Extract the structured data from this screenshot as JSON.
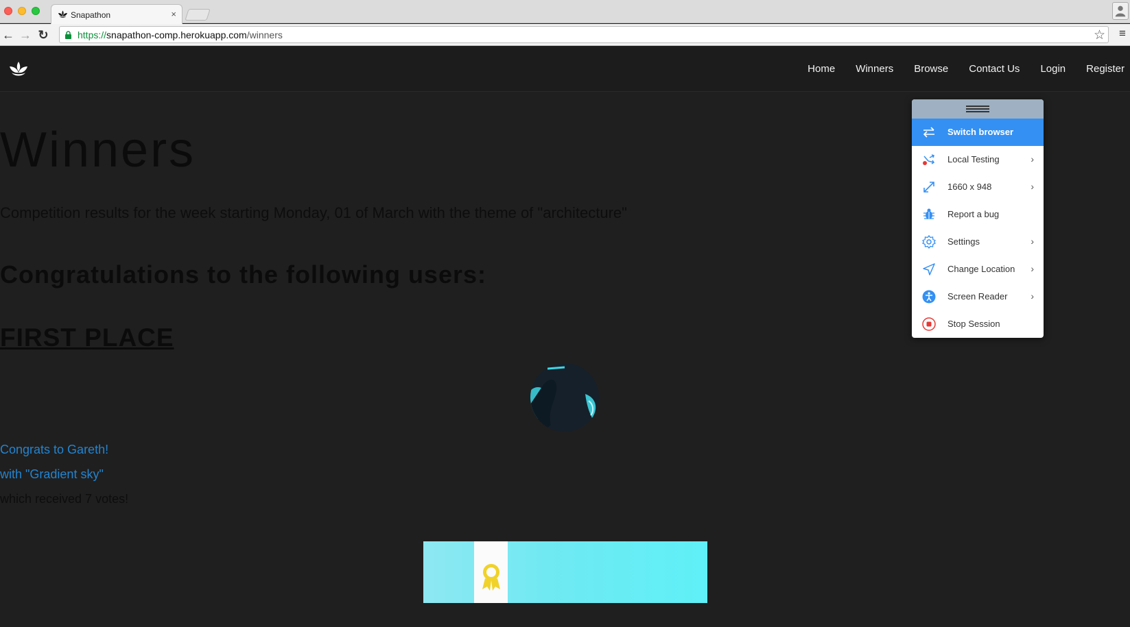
{
  "browser": {
    "tab_title": "Snapathon",
    "tab_close": "×",
    "url_scheme": "https://",
    "url_host": "snapathon-comp.herokuapp.com",
    "url_path": "/winners",
    "back_glyph": "←",
    "forward_glyph": "→",
    "reload_glyph": "↻",
    "star_glyph": "☆",
    "menu_glyph": "≡"
  },
  "nav": {
    "links": [
      "Home",
      "Winners",
      "Browse",
      "Contact Us",
      "Login",
      "Register"
    ]
  },
  "page": {
    "heading": "Winners",
    "subtitle": "Competition results for the week starting Monday, 01 of March with the theme of \"architecture\"",
    "congrats_heading": "Congratulations to the following users:",
    "place_label": "FIRST PLACE",
    "winner_line": "Congrats to Gareth!",
    "photo_line": "with \"Gradient sky\"",
    "votes_line": "which received 7 votes!"
  },
  "bs_menu": {
    "items": [
      {
        "label": "Switch browser",
        "icon": "switch-icon",
        "chevron": ""
      },
      {
        "label": "Local Testing",
        "icon": "local-testing-icon",
        "chevron": "›"
      },
      {
        "label": "1660 x 948",
        "icon": "resize-icon",
        "chevron": "›"
      },
      {
        "label": "Report a bug",
        "icon": "bug-icon",
        "chevron": ""
      },
      {
        "label": "Settings",
        "icon": "gear-icon",
        "chevron": "›"
      },
      {
        "label": "Change Location",
        "icon": "location-arrow-icon",
        "chevron": "›"
      },
      {
        "label": "Screen Reader",
        "icon": "accessibility-icon",
        "chevron": "›"
      },
      {
        "label": "Stop Session",
        "icon": "stop-icon",
        "chevron": ""
      }
    ]
  },
  "colors": {
    "page_bg": "#1f1f1f",
    "link_blue": "#2384d0",
    "bs_active": "#3490f3",
    "stop_red": "#e53935"
  }
}
